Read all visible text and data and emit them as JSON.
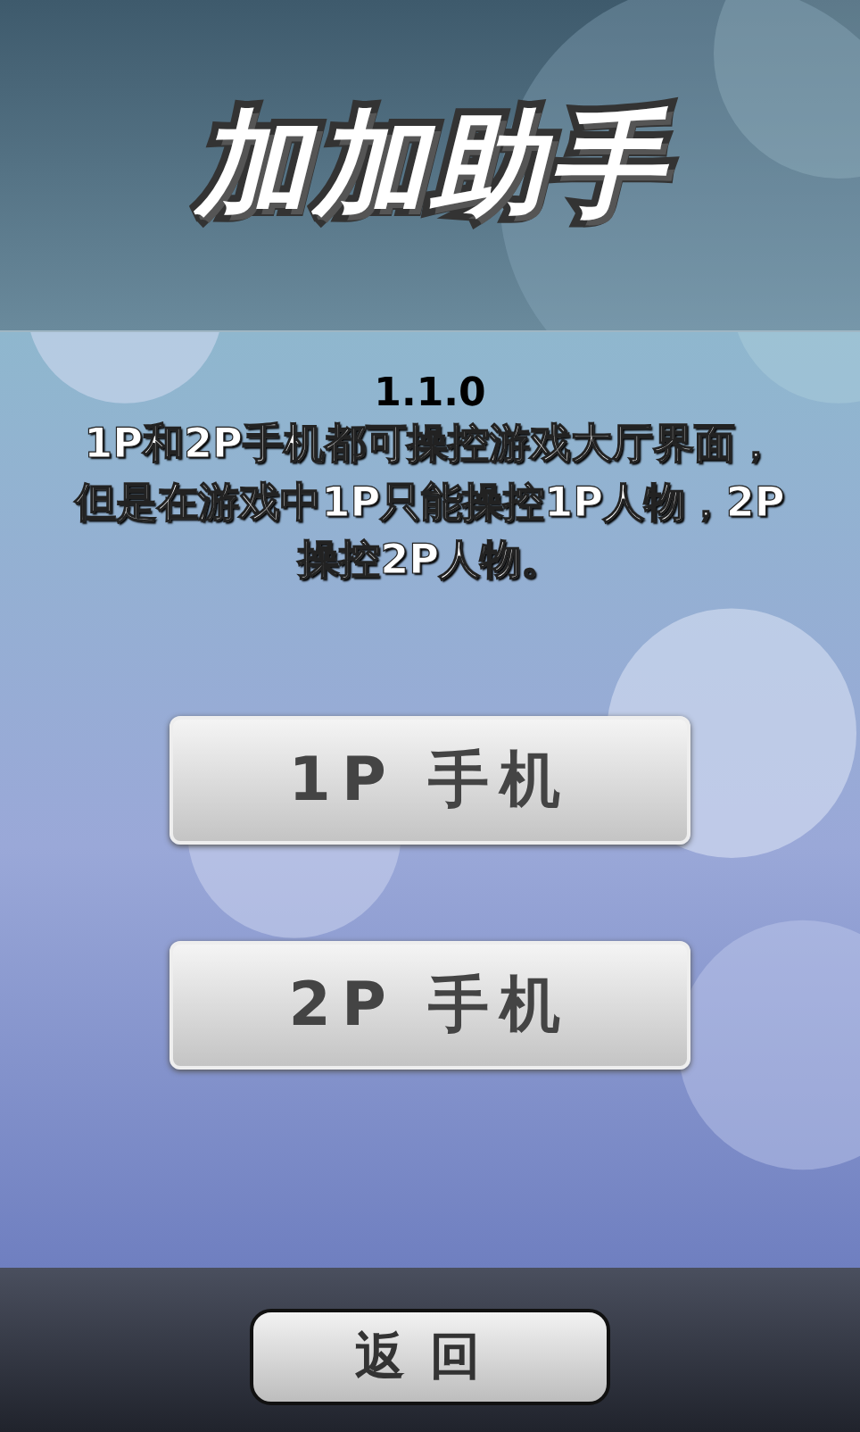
{
  "header": {
    "logo": "加加助手"
  },
  "info": {
    "version": "1.1.0",
    "description": "1P和2P手机都可操控游戏大厅界面，但是在游戏中1P只能操控1P人物，2P操控2P人物。"
  },
  "buttons": [
    {
      "label": "1P 手机"
    },
    {
      "label": "2P 手机"
    }
  ],
  "footer": {
    "back": "返回"
  }
}
